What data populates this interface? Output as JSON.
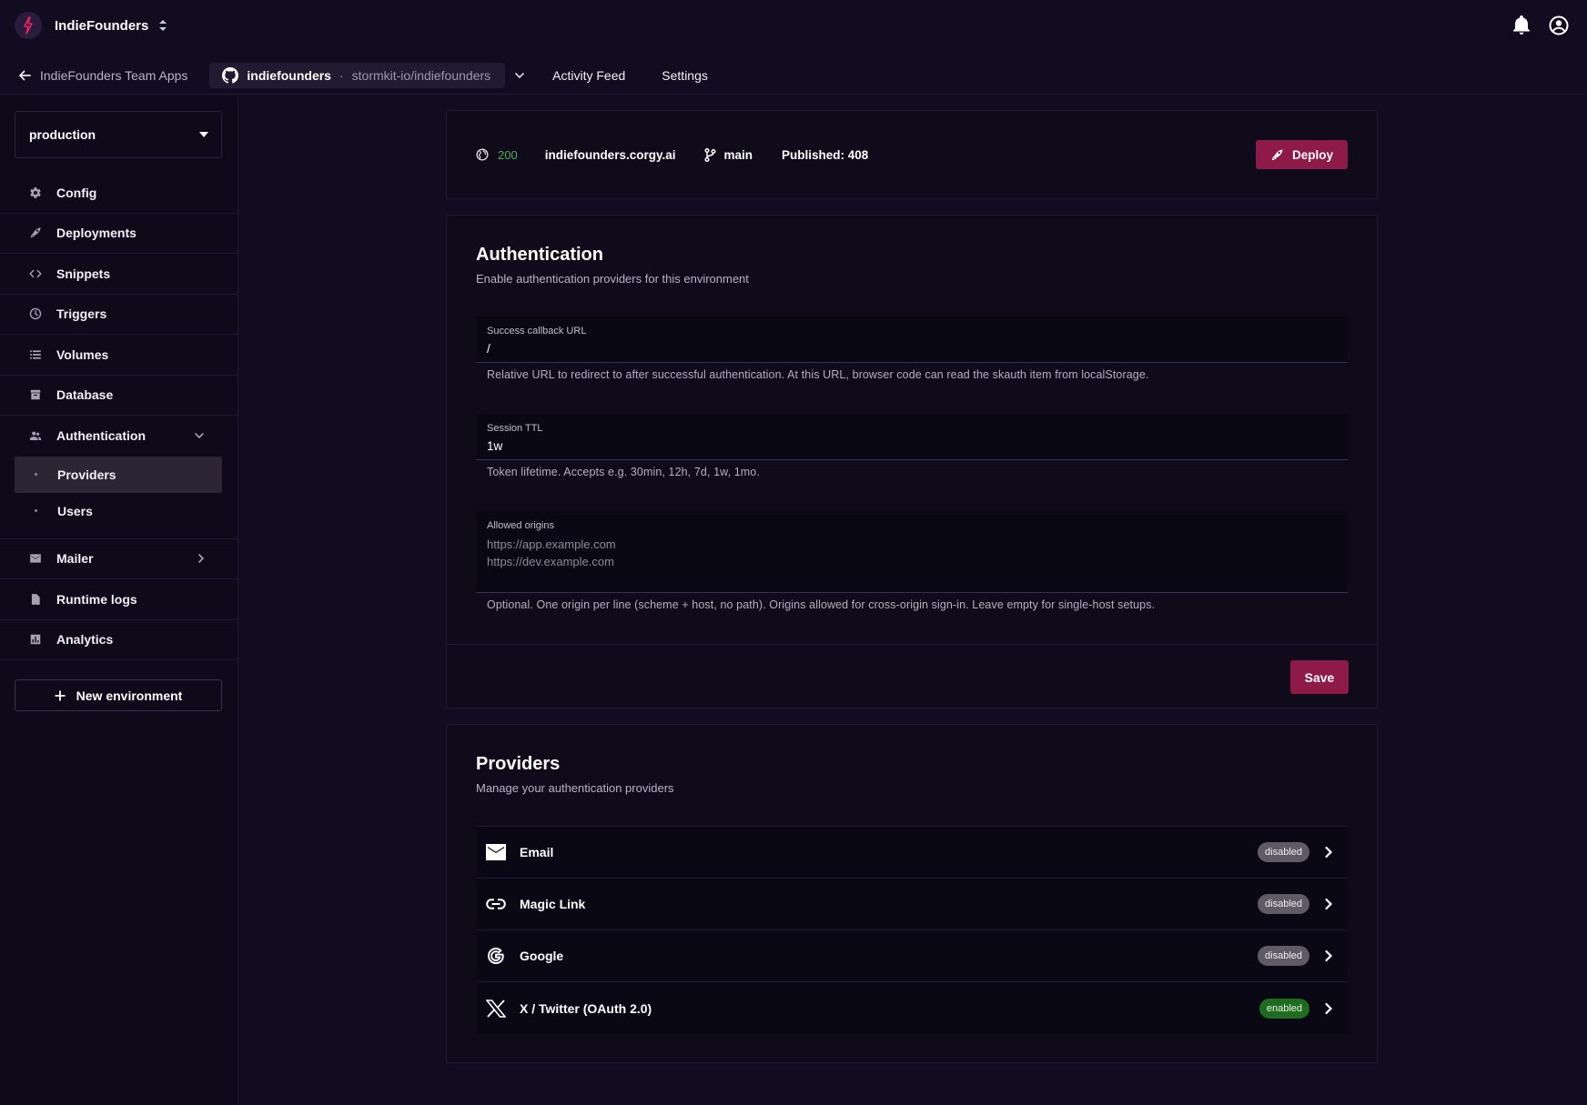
{
  "topbar": {
    "team_name": "IndieFounders"
  },
  "appnav": {
    "back_label": "IndieFounders Team Apps",
    "repo_name": "indiefounders",
    "repo_separator": "·",
    "repo_path": "stormkit-io/indiefounders",
    "links": [
      "Activity Feed",
      "Settings"
    ]
  },
  "sidebar": {
    "environment": "production",
    "items": [
      {
        "label": "Config",
        "icon": "gear-icon"
      },
      {
        "label": "Deployments",
        "icon": "rocket-icon"
      },
      {
        "label": "Snippets",
        "icon": "code-icon"
      },
      {
        "label": "Triggers",
        "icon": "clock-icon"
      },
      {
        "label": "Volumes",
        "icon": "list-icon"
      },
      {
        "label": "Database",
        "icon": "archive-icon"
      },
      {
        "label": "Authentication",
        "icon": "people-icon"
      },
      {
        "label": "Mailer",
        "icon": "mail-icon"
      },
      {
        "label": "Runtime logs",
        "icon": "document-icon"
      },
      {
        "label": "Analytics",
        "icon": "chart-icon"
      }
    ],
    "auth_sub_items": [
      "Providers",
      "Users"
    ],
    "active_sub_item": "Providers",
    "new_env_label": "New environment"
  },
  "status": {
    "code": "200",
    "domain": "indiefounders.corgy.ai",
    "branch": "main",
    "published": "Published: 408",
    "deploy_label": "Deploy"
  },
  "auth": {
    "title": "Authentication",
    "subtitle": "Enable authentication providers for this environment",
    "callback_label": "Success callback URL",
    "callback_value": "/",
    "callback_help": "Relative URL to redirect to after successful authentication. At this URL, browser code can read the skauth item from localStorage.",
    "ttl_label": "Session TTL",
    "ttl_value": "1w",
    "ttl_help": "Token lifetime. Accepts e.g. 30min, 12h, 7d, 1w, 1mo.",
    "origins_label": "Allowed origins",
    "origins_placeholder_1": "https://app.example.com",
    "origins_placeholder_2": "https://dev.example.com",
    "origins_help": "Optional. One origin per line (scheme + host, no path). Origins allowed for cross-origin sign-in. Leave empty for single-host setups.",
    "save_label": "Save"
  },
  "providers": {
    "title": "Providers",
    "subtitle": "Manage your authentication providers",
    "rows": [
      {
        "name": "Email",
        "status": "disabled",
        "icon": "envelope-icon"
      },
      {
        "name": "Magic Link",
        "status": "disabled",
        "icon": "link-icon"
      },
      {
        "name": "Google",
        "status": "disabled",
        "icon": "google-icon"
      },
      {
        "name": "X / Twitter (OAuth 2.0)",
        "status": "enabled",
        "icon": "x-logo-icon"
      }
    ]
  },
  "colors": {
    "background": "#110c1f",
    "accent": "#8e1a47",
    "status_ok": "#4caf50",
    "badge_enabled": "#1f6b1f",
    "badge_disabled": "#5f5a66"
  }
}
